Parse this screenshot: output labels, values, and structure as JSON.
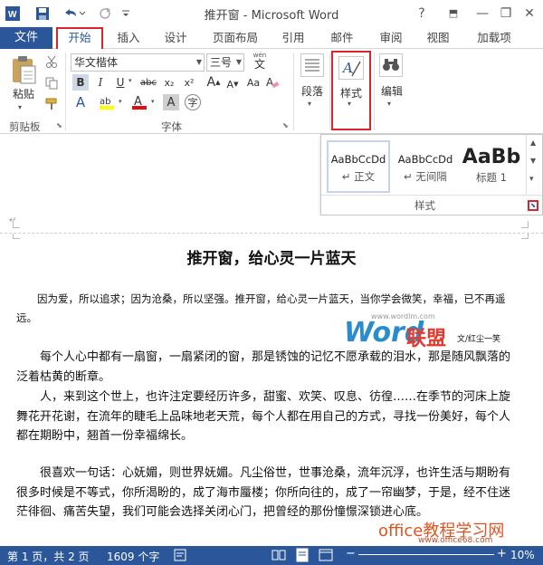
{
  "window": {
    "title": "推开窗 - Microsoft Word",
    "help": "?",
    "minimize": "—",
    "restore": "❐",
    "close": "✕",
    "ribbon_display": "⬒"
  },
  "tabs": [
    "文件",
    "开始",
    "插入",
    "设计",
    "页面布局",
    "引用",
    "邮件",
    "审阅",
    "视图",
    "加载项"
  ],
  "ribbon": {
    "clipboard": {
      "paste": "粘贴",
      "label": "剪贴板"
    },
    "font": {
      "name": "华文楷体",
      "size": "三号",
      "wen": "wén",
      "wen_char": "文",
      "label": "字体",
      "bold": "B",
      "italic": "I",
      "underline": "U",
      "strike": "abc",
      "sub": "x₂",
      "sup": "x²",
      "grow": "A",
      "shrink": "A",
      "case": "Aa",
      "clear": "A",
      "effects": "A",
      "highlight": "ab",
      "color": "A",
      "char_shade": "A",
      "enclose": "字"
    },
    "paragraph": {
      "label": "段落"
    },
    "styles": {
      "label": "样式",
      "big_button": "样式"
    },
    "editing": {
      "label": "编辑"
    }
  },
  "gallery": {
    "items": [
      {
        "preview": "AaBbCcDd",
        "name": "↵ 正文"
      },
      {
        "preview": "AaBbCcDd",
        "name": "↵ 无间隔"
      },
      {
        "preview": "AaBb",
        "name": "标题 1"
      }
    ],
    "label": "样式"
  },
  "document": {
    "title": "推开窗，给心灵一片蓝天",
    "intro": "因为爱，所以追求；因为沧桑，所以坚强。推开窗，给心灵一片蓝天，当你学会微笑，幸福，已不再遥远。",
    "author": "文/红尘一笑",
    "paragraphs": [
      "每个人心中都有一扇窗，一扇紧闭的窗，那是锈蚀的记忆不愿承载的泪水，那是随风飘落的泛着枯黄的断章。",
      "人，来到这个世上，也许注定要经历许多，甜蜜、欢笑、叹息、彷徨……在季节的河床上旋舞花开花谢，在流年的睫毛上品味地老天荒，每个人都在用自己的方式，寻找一份美好，每个人都在期盼中，翘首一份幸福绵长。",
      "很喜欢一句话：心妩媚，则世界妩媚。凡尘俗世，世事沧桑，流年沉浮，也许生活与期盼有很多时候是不等式，你所渴盼的，成了海市蜃楼；你所向往的，成了一帘幽梦，于是，经不住迷茫徘徊、痛苦失望，我们可能会选择关闭心门，把曾经的那份憧憬深锁进心底。"
    ]
  },
  "watermark": {
    "url": "www.wordlm.com",
    "word": "Word",
    "lianmeng": "联盟",
    "office": "office教程学习网",
    "office_url": "www.office68.com"
  },
  "status": {
    "page": "第 1 页，共 2 页",
    "words": "1609 个字",
    "zoom": "10%"
  },
  "colors": {
    "brand": "#2b579a",
    "highlight_box": "#d8262e"
  }
}
